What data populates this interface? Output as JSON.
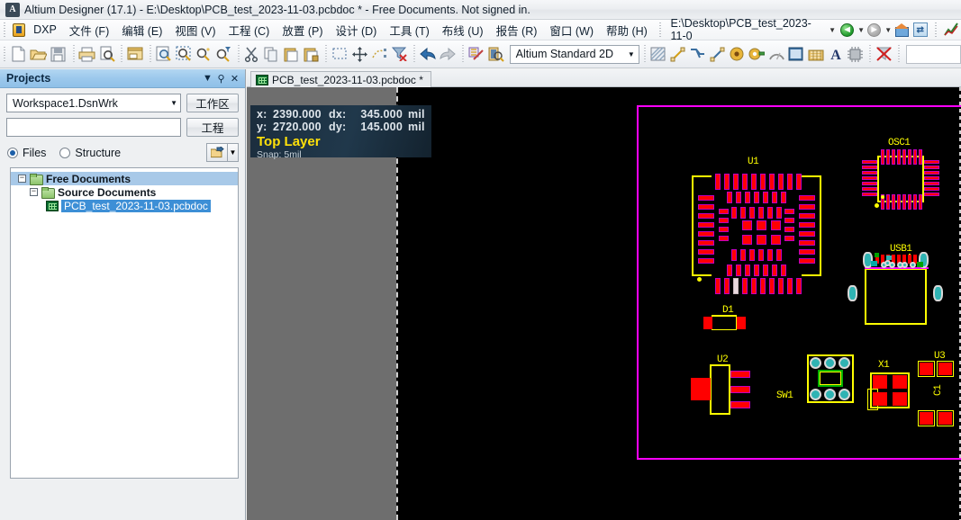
{
  "window": {
    "app_icon": "altium-icon",
    "title": "Altium Designer (17.1) - E:\\Desktop\\PCB_test_2023-11-03.pcbdoc * - Free Documents. Not signed in."
  },
  "menubar": {
    "dxp_label": "DXP",
    "items": [
      "文件 (F)",
      "编辑 (E)",
      "视图 (V)",
      "工程 (C)",
      "放置 (P)",
      "设计 (D)",
      "工具 (T)",
      "布线 (U)",
      "报告 (R)",
      "窗口 (W)",
      "帮助 (H)"
    ],
    "path_combo": "E:\\Desktop\\PCB_test_2023-11-0",
    "nav_back_icon": "back-arrow-icon",
    "nav_forward_icon": "forward-arrow-icon",
    "home_icon": "home-icon",
    "refresh_icon": "refresh-icon",
    "chart_icon": "chart-icon"
  },
  "toolbar": {
    "group1": [
      "new-document-icon",
      "open-folder-icon",
      "save-icon"
    ],
    "group2": [
      "print-icon",
      "print-preview-icon"
    ],
    "group3": [
      "tile-windows-icon"
    ],
    "group4": [
      "zoom-document-icon",
      "zoom-area-icon",
      "zoom-in-icon",
      "zoom-filter-icon"
    ],
    "group5": [
      "cut-scissors-icon",
      "copy-icon",
      "paste-icon",
      "paste-special-icon"
    ],
    "group6": [
      "select-area-icon",
      "move-icon",
      "deselect-icon",
      "clear-filter-icon"
    ],
    "group7": [
      "undo-icon",
      "redo-icon"
    ],
    "group8": [
      "cross-probe-icon",
      "browse-component-icon"
    ],
    "view_config": "Altium Standard 2D",
    "group9": [
      "polygon-pour-icon",
      "place-line-icon",
      "place-track-icon",
      "interactive-route-icon",
      "place-via-icon",
      "place-pad-icon",
      "place-arc-icon",
      "place-fill-icon",
      "place-region-icon",
      "place-string-icon",
      "place-component-icon"
    ],
    "group10": [
      "clear-all-icon"
    ]
  },
  "projects_panel": {
    "title": "Projects",
    "dropdown_icon": "chevron-down-icon",
    "pin_icon": "pin-icon",
    "close_icon": "close-icon",
    "workspace_value": "Workspace1.DsnWrk",
    "workspace_button": "工作区",
    "project_value": "",
    "project_button": "工程",
    "radio_files": "Files",
    "radio_structure": "Structure",
    "radio_selected": "Files",
    "explore_icon": "explore-icon",
    "tree": [
      {
        "label": "Free Documents",
        "icon": "folder-icon",
        "level": 0,
        "expander": "-",
        "highlight": "light"
      },
      {
        "label": "Source Documents",
        "icon": "folder-icon",
        "level": 1,
        "expander": "-",
        "highlight": "none"
      },
      {
        "label": "PCB_test_2023-11-03.pcbdoc",
        "icon": "pcb-document-icon",
        "level": 2,
        "expander": "",
        "highlight": "selected"
      }
    ]
  },
  "editor": {
    "document_tab": {
      "icon": "pcb-document-icon",
      "label": "PCB_test_2023-11-03.pcbdoc *"
    },
    "status_overlay": {
      "x_key": "x:",
      "x_value": "2390.000",
      "dx_key": "dx:",
      "dx_value": "345.000",
      "dx_unit": "mil",
      "y_key": "y:",
      "y_value": "2720.000",
      "dy_key": "dy:",
      "dy_value": "145.000",
      "dy_unit": "mil",
      "layer": "Top Layer",
      "snap": "Snap: 5mil"
    },
    "board": {
      "outline_color": "#ff00ff",
      "background": "#000000",
      "workspace_color": "#6e6e6e"
    },
    "components": [
      {
        "designator": "U1",
        "type": "qfp-footprint"
      },
      {
        "designator": "OSC1",
        "type": "qfp-oscillator-footprint"
      },
      {
        "designator": "USB1",
        "type": "usb-connector-footprint"
      },
      {
        "designator": "D1",
        "type": "diode-footprint"
      },
      {
        "designator": "U2",
        "type": "sot-footprint"
      },
      {
        "designator": "SW1",
        "type": "tactile-switch-footprint"
      },
      {
        "designator": "X1",
        "type": "crystal-footprint"
      },
      {
        "designator": "U3",
        "type": "two-pad-footprint"
      },
      {
        "designator": "C1",
        "type": "capacitor-footprint"
      }
    ]
  }
}
